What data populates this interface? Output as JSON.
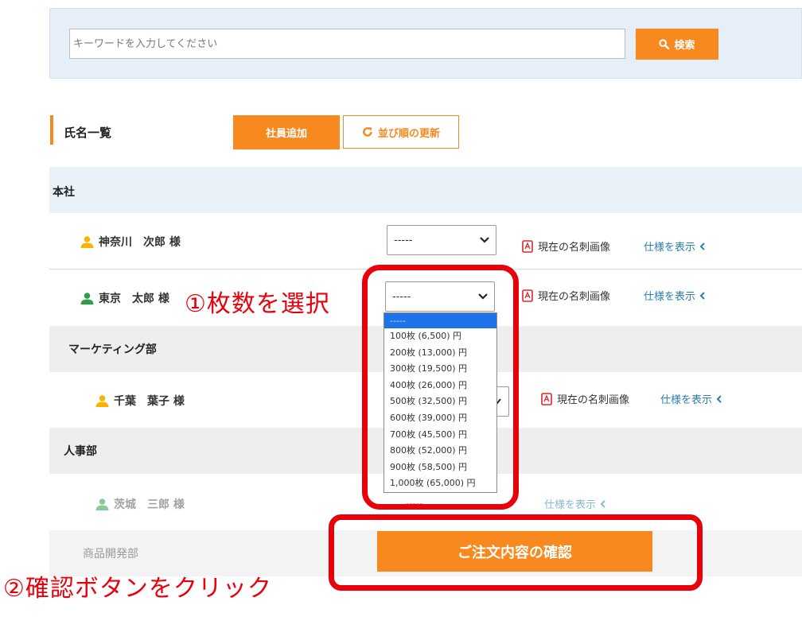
{
  "search": {
    "placeholder": "キーワードを入力してください",
    "button_label": "検索"
  },
  "list_header": {
    "title": "氏名一覧",
    "add_button": "社員追加",
    "refresh_button": "並び順の更新"
  },
  "groups": [
    {
      "name": "本社",
      "members": [
        {
          "name": "神奈川　次郎 様",
          "quantity": "-----",
          "image_link": "現在の名刺画像",
          "spec_link": "仕様を表示"
        },
        {
          "name": "東京　太郎 様",
          "quantity": "-----",
          "image_link": "現在の名刺画像",
          "spec_link": "仕様を表示"
        }
      ]
    },
    {
      "name": "マーケティング部",
      "members": [
        {
          "name": "千葉　葉子 様",
          "image_link": "現在の名刺画像",
          "spec_link": "仕様を表示"
        }
      ]
    },
    {
      "name": "人事部",
      "members": [
        {
          "name": "茨城　三郎 様",
          "quantity": "-----",
          "spec_link": "仕様を表示"
        }
      ]
    },
    {
      "name": "商品開発部",
      "members": []
    }
  ],
  "dropdown": {
    "selected": "-----",
    "options": [
      "100枚 (6,500) 円",
      "200枚 (13,000) 円",
      "300枚 (19,500) 円",
      "400枚 (26,000) 円",
      "500枚 (32,500) 円",
      "600枚 (39,000) 円",
      "700枚 (45,500) 円",
      "800枚 (52,000) 円",
      "900枚 (58,500) 円",
      "1,000枚 (65,000) 円"
    ]
  },
  "confirm_button": "ご注文内容の確認",
  "annotations": {
    "step1": "①枚数を選択",
    "step2": "②確認ボタンをクリック"
  },
  "colors": {
    "accent": "#f7891e",
    "annotation": "#e8000b",
    "link": "#2a7fb0",
    "group_bg": "#e9f1f9",
    "person_icon_active": "#2e9e48",
    "person_icon": "#f5b400"
  }
}
